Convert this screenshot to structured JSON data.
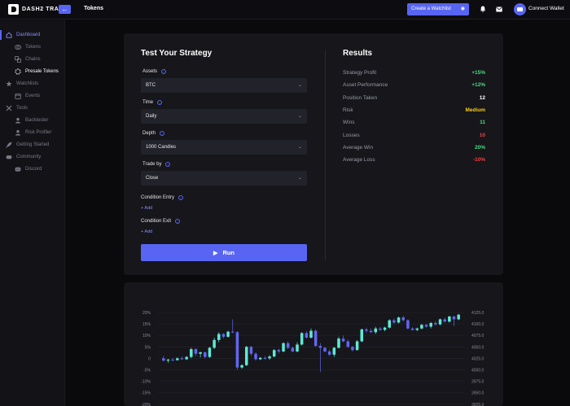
{
  "topbar": {
    "logo_text": "DASH2 TRADE",
    "back_icon": "arrow-left-icon",
    "title": "Tokens",
    "create_watchlist": "Create a Watchlist",
    "connect_wallet": "Connect Wallet",
    "accent": "#5865f2"
  },
  "sidebar": {
    "items": [
      {
        "label": "Dashboard",
        "icon": "home-icon"
      },
      {
        "label": "Tokens",
        "icon": "coins-icon"
      },
      {
        "label": "Chains",
        "icon": "chain-icon"
      },
      {
        "label": "Presale Tokens",
        "icon": "presale-icon"
      },
      {
        "label": "Watchlists",
        "icon": "star-icon"
      },
      {
        "label": "Events",
        "icon": "calendar-icon"
      },
      {
        "label": "Tools",
        "icon": "tools-icon"
      },
      {
        "label": "Backtester",
        "icon": "backtester-icon"
      },
      {
        "label": "Risk Profiler",
        "icon": "risk-icon"
      },
      {
        "label": "Getting Started",
        "icon": "rocket-icon"
      },
      {
        "label": "Community",
        "icon": "community-icon"
      },
      {
        "label": "Discord",
        "icon": "discord-icon"
      }
    ]
  },
  "strategy": {
    "title": "Test Your Strategy",
    "assets_label": "Assets",
    "assets_value": "BTC",
    "time_label": "Time",
    "time_value": "Daily",
    "depth_label": "Depth",
    "depth_value": "1000 Candles",
    "trade_by_label": "Trade by",
    "trade_by_value": "Close",
    "entry_label": "Condition Entry",
    "exit_label": "Condition Exit",
    "add_label": "+ Add",
    "run_label": "Run"
  },
  "results": {
    "title": "Results",
    "rows": [
      {
        "key": "Strategy Profit",
        "value": "+15%",
        "color": "#4ade80"
      },
      {
        "key": "Asset Performance",
        "value": "+12%",
        "color": "#4ade80"
      },
      {
        "key": "Position Taken",
        "value": "12",
        "color": "#ffffff"
      },
      {
        "key": "Risk",
        "value": "Medium",
        "color": "#facc15"
      },
      {
        "key": "Wins",
        "value": "11",
        "color": "#4ade80"
      },
      {
        "key": "Losses",
        "value": "10",
        "color": "#ef4444"
      },
      {
        "key": "Average Win",
        "value": "20%",
        "color": "#4ade80"
      },
      {
        "key": "Average Loss",
        "value": "-10%",
        "color": "#ef4444"
      }
    ]
  },
  "chart_data": {
    "type": "candlestick",
    "left_axis_ticks": [
      "20%",
      "15%",
      "10%",
      "5%",
      "0",
      "-5%",
      "-10%",
      "-15%",
      "-20%"
    ],
    "right_axis_ticks": [
      "4125.0",
      "4100.0",
      "4075.0",
      "4050.0",
      "4025.0",
      "4000.0",
      "3975.0",
      "3950.0",
      "3925.0"
    ],
    "left_range": [
      -20,
      20
    ],
    "right_range": [
      3925,
      4125
    ],
    "up_color": "#5eead4",
    "down_color": "#6366f1",
    "candles": [
      [
        4025,
        4030,
        4018,
        4020
      ],
      [
        4020,
        4024,
        4015,
        4022
      ],
      [
        4022,
        4026,
        4019,
        4021
      ],
      [
        4021,
        4027,
        4020,
        4025
      ],
      [
        4025,
        4029,
        4022,
        4023
      ],
      [
        4023,
        4030,
        4021,
        4028
      ],
      [
        4028,
        4048,
        4025,
        4045
      ],
      [
        4045,
        4047,
        4030,
        4035
      ],
      [
        4035,
        4040,
        4027,
        4038
      ],
      [
        4038,
        4040,
        4025,
        4028
      ],
      [
        4028,
        4050,
        4026,
        4048
      ],
      [
        4048,
        4070,
        4045,
        4065
      ],
      [
        4065,
        4082,
        4060,
        4078
      ],
      [
        4078,
        4080,
        4068,
        4072
      ],
      [
        4072,
        4085,
        4070,
        4083
      ],
      [
        4083,
        4110,
        4080,
        4082
      ],
      [
        4082,
        4084,
        4000,
        4005
      ],
      [
        4005,
        4012,
        4002,
        4010
      ],
      [
        4010,
        4052,
        4008,
        4050
      ],
      [
        4050,
        4052,
        4030,
        4035
      ],
      [
        4035,
        4038,
        4020,
        4023
      ],
      [
        4023,
        4028,
        4021,
        4026
      ],
      [
        4026,
        4030,
        4022,
        4025
      ],
      [
        4025,
        4032,
        4022,
        4029
      ],
      [
        4029,
        4045,
        4027,
        4043
      ],
      [
        4043,
        4046,
        4036,
        4040
      ],
      [
        4040,
        4060,
        4038,
        4058
      ],
      [
        4058,
        4062,
        4045,
        4048
      ],
      [
        4048,
        4050,
        4038,
        4040
      ],
      [
        4040,
        4060,
        4038,
        4055
      ],
      [
        4055,
        4082,
        4053,
        4080
      ],
      [
        4080,
        4084,
        4068,
        4070
      ],
      [
        4070,
        4090,
        4068,
        4085
      ],
      [
        4085,
        4088,
        4050,
        4052
      ],
      [
        4052,
        4058,
        3995,
        4048
      ],
      [
        4048,
        4050,
        4038,
        4040
      ],
      [
        4040,
        4044,
        4030,
        4033
      ],
      [
        4033,
        4050,
        4028,
        4048
      ],
      [
        4048,
        4072,
        4046,
        4068
      ],
      [
        4068,
        4075,
        4060,
        4062
      ],
      [
        4062,
        4066,
        4048,
        4050
      ],
      [
        4050,
        4052,
        4040,
        4043
      ],
      [
        4043,
        4065,
        4042,
        4062
      ],
      [
        4062,
        4090,
        4060,
        4088
      ],
      [
        4088,
        4092,
        4080,
        4085
      ],
      [
        4085,
        4090,
        4080,
        4082
      ],
      [
        4082,
        4094,
        4078,
        4090
      ],
      [
        4090,
        4094,
        4085,
        4087
      ],
      [
        4087,
        4094,
        4084,
        4092
      ],
      [
        4092,
        4110,
        4090,
        4108
      ],
      [
        4108,
        4112,
        4100,
        4103
      ],
      [
        4103,
        4116,
        4101,
        4114
      ],
      [
        4114,
        4118,
        4105,
        4108
      ],
      [
        4108,
        4110,
        4088,
        4090
      ],
      [
        4090,
        4093,
        4085,
        4087
      ],
      [
        4087,
        4092,
        4084,
        4090
      ],
      [
        4090,
        4100,
        4088,
        4098
      ],
      [
        4098,
        4100,
        4092,
        4094
      ],
      [
        4094,
        4104,
        4090,
        4102
      ],
      [
        4102,
        4106,
        4096,
        4099
      ],
      [
        4099,
        4112,
        4097,
        4110
      ],
      [
        4110,
        4114,
        4103,
        4105
      ],
      [
        4105,
        4118,
        4103,
        4116
      ],
      [
        4116,
        4118,
        4095,
        4110
      ],
      [
        4110,
        4122,
        4108,
        4120
      ]
    ]
  }
}
